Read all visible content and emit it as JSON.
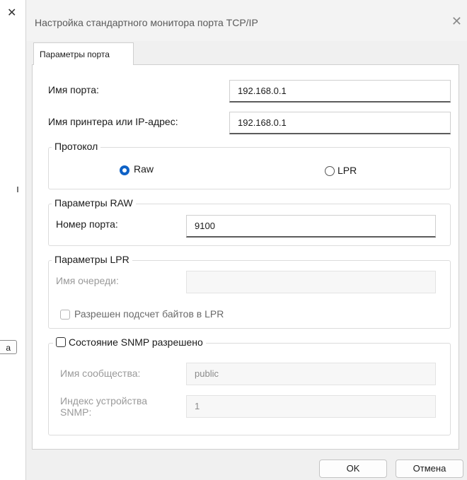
{
  "background": {
    "close_glyph": "✕",
    "button_label": "а"
  },
  "dialog": {
    "title": "Настройка стандартного монитора порта TCP/IP",
    "close_glyph": "✕"
  },
  "tab": {
    "label": "Параметры порта"
  },
  "port_name": {
    "label": "Имя порта:",
    "value": "192.168.0.1"
  },
  "printer_address": {
    "label": "Имя принтера или IP-адрес:",
    "value": "192.168.0.1"
  },
  "protocol": {
    "legend": "Протокол",
    "options": [
      {
        "label": "Raw",
        "selected": true
      },
      {
        "label": "LPR",
        "selected": false
      }
    ]
  },
  "raw": {
    "legend": "Параметры RAW",
    "port_label": "Номер порта:",
    "port_value": "9100"
  },
  "lpr": {
    "legend": "Параметры LPR",
    "queue_label": "Имя очереди:",
    "queue_value": "",
    "byte_count_label": "Разрешен подсчет байтов в LPR"
  },
  "snmp": {
    "enabled_label": "Состояние SNMP разрешено",
    "community_label": "Имя сообщества:",
    "community_value": "public",
    "device_index_label_line1": "Индекс устройства",
    "device_index_label_line2": "SNMP:",
    "device_index_value": "1"
  },
  "buttons": {
    "ok": "OK",
    "cancel": "Отмена"
  },
  "colors": {
    "accent": "#0f62c6",
    "dialog_bg": "#f0f0f0",
    "panel_bg": "#ffffff"
  }
}
